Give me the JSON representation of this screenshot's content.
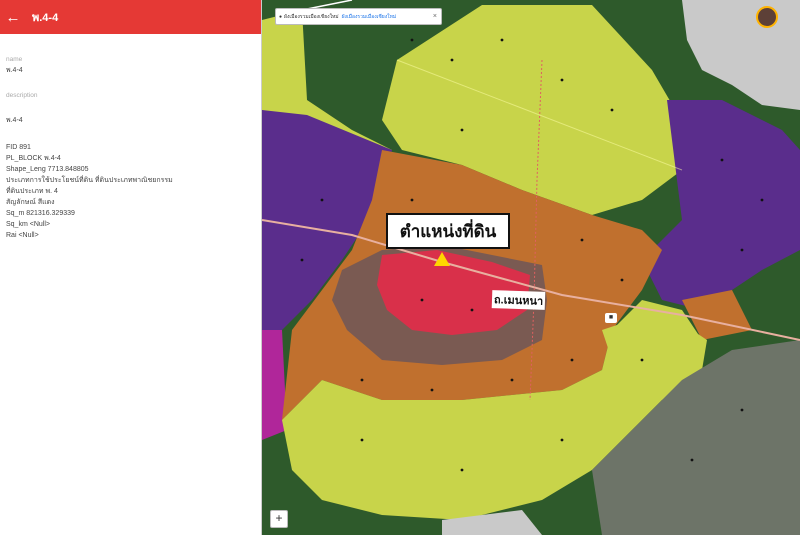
{
  "panel": {
    "title": "พ.4-4",
    "back_icon": "arrow-left-icon",
    "fields": [
      {
        "label": "name",
        "value": "พ.4-4"
      },
      {
        "label": "description",
        "value": "พ.4-4"
      }
    ],
    "attributes": [
      "FID 891",
      "PL_BLOCK พ.4-4",
      "Shape_Leng 7713.848805",
      "ประเภทการใช้ประโยชน์ที่ดิน ที่ดินประเภทพาณิชยกรรม",
      "ที่ดินประเภท พ. 4",
      "สัญลักษณ์ สีแดง",
      "Sq_m 821316.329339",
      "Sq_km <Null>",
      "Rai <Null>"
    ]
  },
  "map": {
    "search_text": "ผังเมืองรวมเมืองเชียงใหม่",
    "search_chip": "ผังเมืองรวมเมืองเชียงใหม่",
    "close_icon": "close-icon",
    "location_label": "ตำแหน่งที่ดิน",
    "road_label": "ถ.เมนหนา",
    "zoom_in_label": "+",
    "colors": {
      "green": "#2e5a2b",
      "yellow": "#c8d44a",
      "orange": "#c0702e",
      "purple": "#5a2d8c",
      "red": "#d9304a",
      "brown": "#7a5a52",
      "gray": "#6d7468",
      "light": "#c9c9c9",
      "magenta": "#b0269a"
    }
  }
}
